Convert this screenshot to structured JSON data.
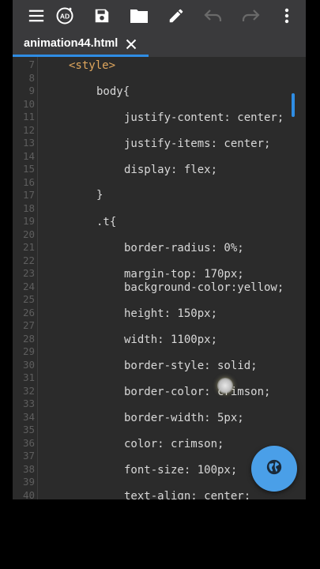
{
  "toolbar": {
    "icons": [
      "menu-icon",
      "ad-icon",
      "save-icon",
      "folder-icon",
      "edit-icon",
      "undo-icon",
      "redo-icon",
      "more-vert-icon"
    ],
    "ad_badge": "AD"
  },
  "tabs": [
    {
      "label": "animation44.html",
      "active": true
    }
  ],
  "editor": {
    "line_numbers": [
      "7",
      "8",
      "9",
      "10",
      "11",
      "12",
      "13",
      "14",
      "15",
      "16",
      "17",
      "18",
      "19",
      "20",
      "21",
      "22",
      "23",
      "24",
      "25",
      "26",
      "27",
      "28",
      "29",
      "30",
      "31",
      "32",
      "33",
      "34",
      "35",
      "36",
      "37",
      "38",
      "39",
      "40"
    ],
    "code_lines": [
      "<style>",
      "body{",
      "justify-content: center;",
      "justify-items: center;",
      "display: flex;",
      "}",
      ".t{",
      "border-radius: 0%;",
      "margin-top: 170px;",
      "background-color:yellow;",
      "height: 150px;",
      "width: 1100px;",
      "border-style: solid;",
      "border-color: crimson;",
      "border-width: 5px;",
      "color: crimson;",
      "font-size: 100px;",
      "text-align: center;"
    ]
  },
  "colors": {
    "toolbar_bg": "#3a3a3c",
    "editor_bg": "#2b2b2b",
    "accent": "#2f8de4",
    "fab": "#4a9fe8",
    "tag": "#e0a75e"
  },
  "fab_icon": "globe-icon"
}
